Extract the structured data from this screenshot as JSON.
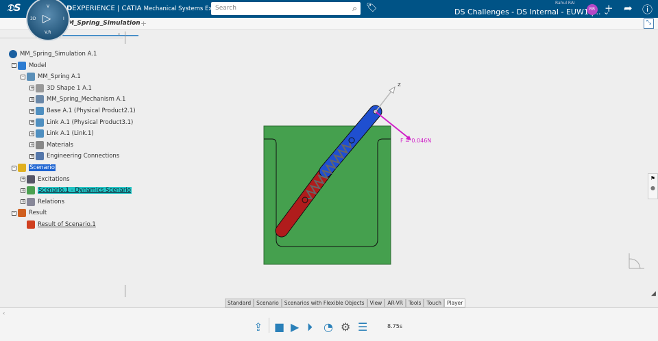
{
  "header": {
    "brand_bold": "3D",
    "brand_rest": "EXPERIENCE | CATIA",
    "app": "Mechanical Systems Exper...",
    "search_placeholder": "Search",
    "user": "Rahul RAI",
    "context": "DS Challenges - DS Internal - EUW1 |...",
    "avatar": "RR",
    "compass": {
      "top": "V",
      "left": "3D",
      "right": "I",
      "bottom": "V.R"
    }
  },
  "tab": {
    "label": "MM_Spring_Simulation"
  },
  "tree": [
    {
      "label": "MM_Spring_Simulation A.1",
      "icon": "simulation-icon"
    },
    {
      "label": "Model",
      "icon": "model-icon"
    },
    {
      "label": "MM_Spring A.1",
      "icon": "product-icon"
    },
    {
      "label": "3D Shape 1 A.1",
      "icon": "shape-icon"
    },
    {
      "label": "MM_Spring_Mechanism A.1",
      "icon": "mechanism-icon"
    },
    {
      "label": "Base A.1 (Physical Product2.1)",
      "icon": "part-icon"
    },
    {
      "label": "Link A.1 (Physical Product3.1)",
      "icon": "part-icon"
    },
    {
      "label": "Link A.1 (Link.1)",
      "icon": "part-icon"
    },
    {
      "label": "Materials",
      "icon": "materials-icon"
    },
    {
      "label": "Engineering Connections",
      "icon": "connections-icon"
    },
    {
      "label": "Scenario",
      "icon": "scenario-icon"
    },
    {
      "label": "Excitations",
      "icon": "excitations-icon"
    },
    {
      "label": "Scenario.1 - Dynamics Scenario",
      "icon": "dynamics-scenario-icon"
    },
    {
      "label": "Relations",
      "icon": "relations-icon"
    },
    {
      "label": "Result",
      "icon": "result-icon"
    },
    {
      "label": "Result of Scenario.1",
      "icon": "result-item-icon"
    }
  ],
  "viewport": {
    "axis_label": "Z",
    "force_label": "F = 0.046N",
    "colors": {
      "base": "#45a04e",
      "link_red": "#b01c1c",
      "link_blue": "#1f4fd0",
      "force": "#d020c8"
    }
  },
  "bottom_tabs": [
    "Standard",
    "Scenario",
    "Scenarios with Flexible Objects",
    "View",
    "AR-VR",
    "Tools",
    "Touch",
    "Player"
  ],
  "active_tab": "Player",
  "player": {
    "time": "8.75s"
  }
}
